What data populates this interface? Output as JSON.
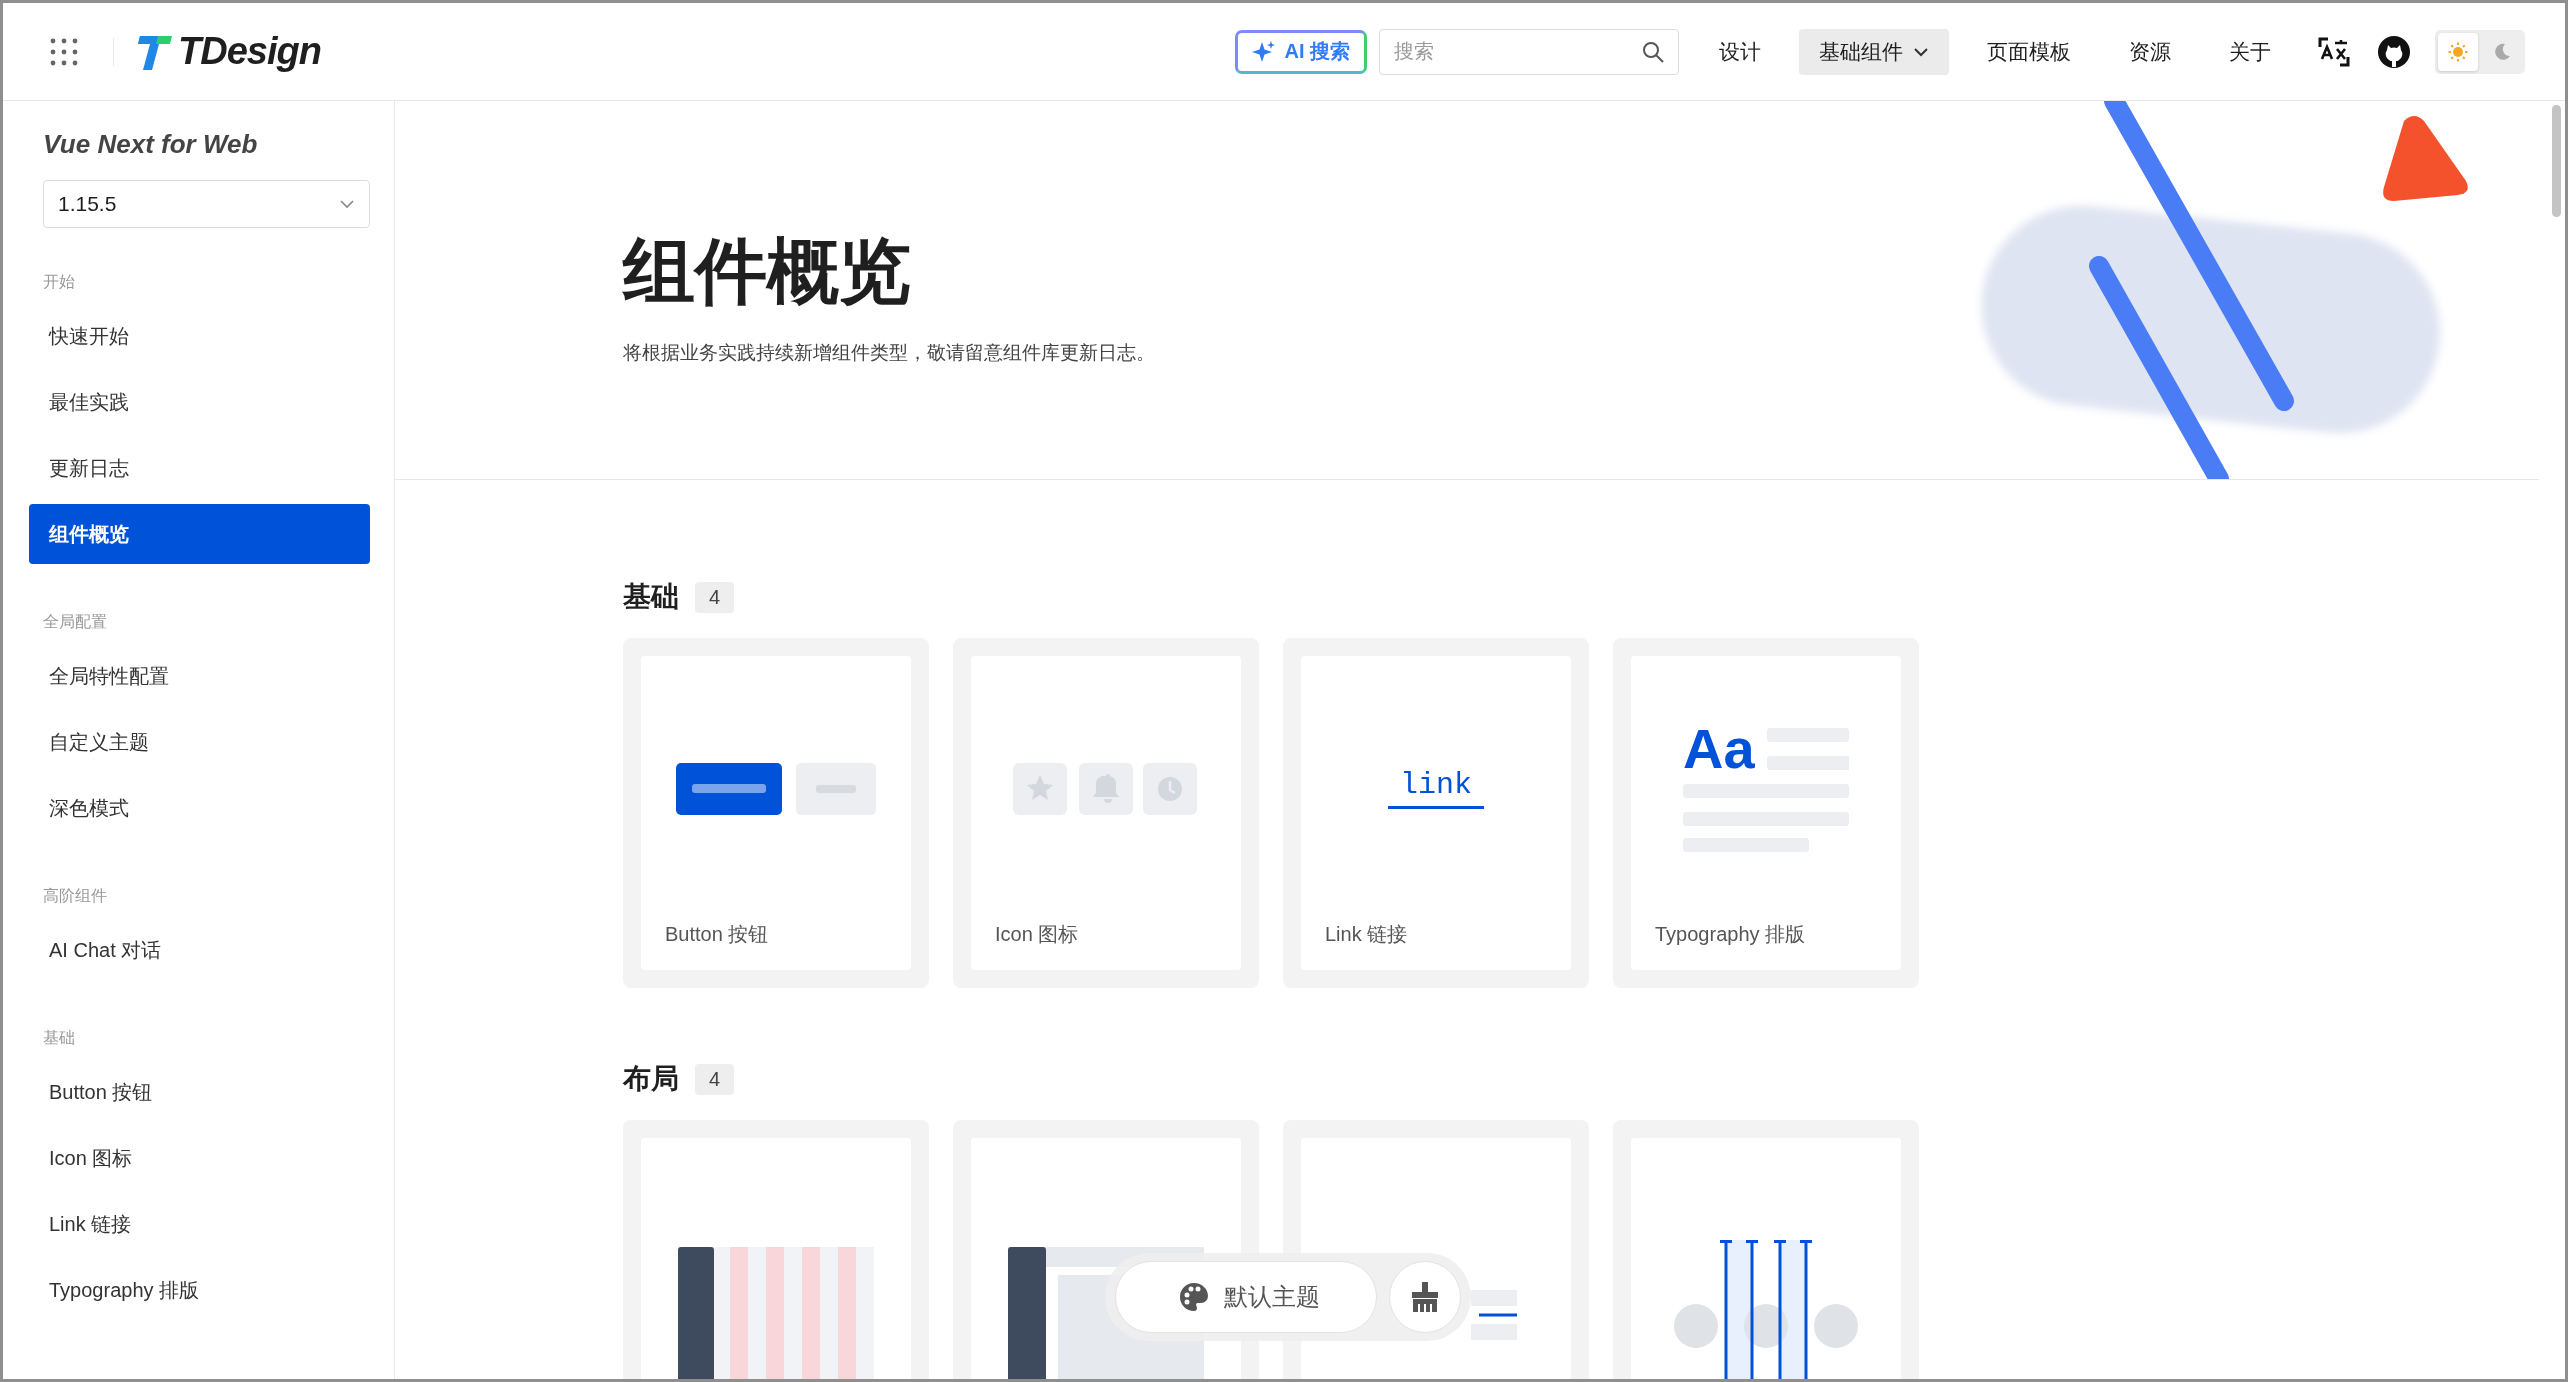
{
  "header": {
    "logo": "TDesign",
    "ai_search": "AI 搜索",
    "search": {
      "placeholder": "搜索"
    },
    "nav": [
      {
        "label": "设计",
        "kind": "link",
        "selected": false
      },
      {
        "label": "基础组件",
        "kind": "dropdown",
        "selected": true
      },
      {
        "label": "页面模板",
        "kind": "link",
        "selected": false
      },
      {
        "label": "资源",
        "kind": "link",
        "selected": false
      },
      {
        "label": "关于",
        "kind": "link",
        "selected": false
      }
    ],
    "theme_options": [
      {
        "kind": "light",
        "selected": true
      },
      {
        "kind": "dark",
        "selected": false
      }
    ]
  },
  "sidebar": {
    "title": "Vue Next for Web",
    "version": "1.15.5",
    "groups": [
      {
        "label": "开始",
        "items": [
          {
            "label": "快速开始",
            "selected": false
          },
          {
            "label": "最佳实践",
            "selected": false
          },
          {
            "label": "更新日志",
            "selected": false
          },
          {
            "label": "组件概览",
            "selected": true
          }
        ]
      },
      {
        "label": "全局配置",
        "items": [
          {
            "label": "全局特性配置",
            "selected": false
          },
          {
            "label": "自定义主题",
            "selected": false
          },
          {
            "label": "深色模式",
            "selected": false
          }
        ]
      },
      {
        "label": "高阶组件",
        "items": [
          {
            "label": "AI Chat 对话",
            "selected": false
          }
        ]
      },
      {
        "label": "基础",
        "items": [
          {
            "label": "Button 按钮",
            "selected": false
          },
          {
            "label": "Icon 图标",
            "selected": false
          },
          {
            "label": "Link 链接",
            "selected": false
          },
          {
            "label": "Typography 排版",
            "selected": false
          }
        ]
      }
    ]
  },
  "hero": {
    "title": "组件概览",
    "subtitle": "将根据业务实践持续新增组件类型，敬请留意组件库更新日志。"
  },
  "sections": [
    {
      "title": "基础",
      "count": "4",
      "cards": [
        {
          "kind": "button",
          "label": "Button 按钮"
        },
        {
          "kind": "icon",
          "label": "Icon 图标"
        },
        {
          "kind": "link",
          "label": "Link 链接",
          "sample": "link"
        },
        {
          "kind": "typography",
          "label": "Typography 排版",
          "sample": "Aa"
        }
      ]
    },
    {
      "title": "布局",
      "count": "4",
      "cards": [
        {
          "kind": "columns"
        },
        {
          "kind": "sidebar"
        },
        {
          "kind": "line"
        },
        {
          "kind": "spacing"
        }
      ]
    }
  ],
  "theme_pill": {
    "label": "默认主题"
  }
}
